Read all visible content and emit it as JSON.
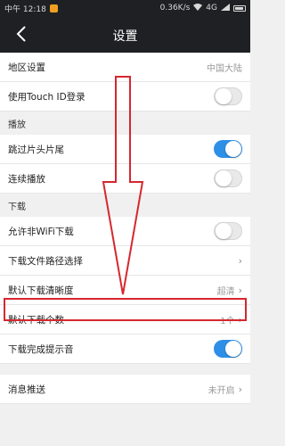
{
  "statusbar": {
    "time": "中午 12:18",
    "speed": "0.36K/s",
    "network": "4G"
  },
  "navbar": {
    "title": "设置"
  },
  "rows_top": [
    {
      "label": "地区设置",
      "value": "中国大陆",
      "kind": "link"
    },
    {
      "label": "使用Touch ID登录",
      "kind": "toggle",
      "on": false
    }
  ],
  "section_play": {
    "title": "播放",
    "rows": [
      {
        "label": "跳过片头片尾",
        "kind": "toggle",
        "on": true
      },
      {
        "label": "连续播放",
        "kind": "toggle",
        "on": false
      }
    ]
  },
  "section_download": {
    "title": "下载",
    "rows": [
      {
        "label": "允许非WiFi下载",
        "kind": "toggle",
        "on": false
      },
      {
        "label": "下载文件路径选择",
        "kind": "link",
        "value": ""
      },
      {
        "label": "默认下载清晰度",
        "kind": "link",
        "value": "超清"
      },
      {
        "label": "默认下载个数",
        "kind": "link",
        "value": "1个"
      },
      {
        "label": "下载完成提示音",
        "kind": "toggle",
        "on": true
      }
    ]
  },
  "rows_bottom": [
    {
      "label": "消息推送",
      "kind": "link",
      "value": "未开启"
    }
  ],
  "colors": {
    "accent": "#2e8fe6",
    "highlight": "#d6272e",
    "header": "#1f2024"
  }
}
